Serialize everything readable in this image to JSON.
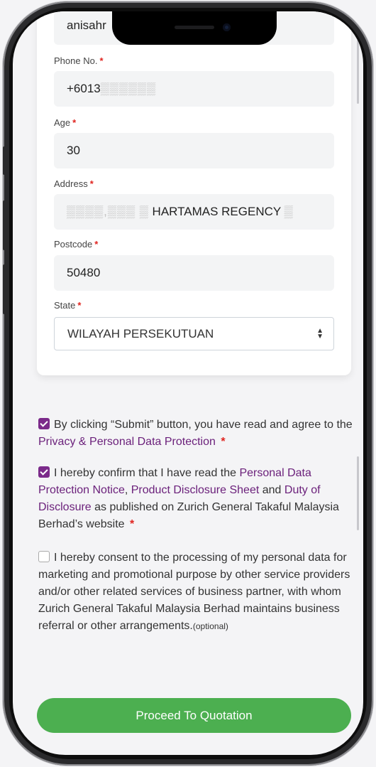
{
  "form": {
    "top_value": "anisahr",
    "phone": {
      "label": "Phone No.",
      "value_prefix": "+6013",
      "value_masked": "▒▒▒▒▒▒"
    },
    "age": {
      "label": "Age",
      "value": "30"
    },
    "address": {
      "label": "Address",
      "value_masked": "▒▒▒▒,▒▒▒ ▒",
      "value_visible": "HARTAMAS REGENCY",
      "value_tail_masked": "▒"
    },
    "postcode": {
      "label": "Postcode",
      "value": "50480"
    },
    "state": {
      "label": "State",
      "value": "WILAYAH PERSEKUTUAN"
    },
    "required_marker": "*"
  },
  "consents": [
    {
      "checked": true,
      "text_1": "By clicking “Submit” button, you have read and agree to the",
      "link_1": "Privacy & Personal Data Protection",
      "required": "*"
    },
    {
      "checked": true,
      "text_1": "I hereby confirm that I have read the",
      "link_1": "Personal Data Protection Notice",
      "sep_1": ",",
      "link_2": "Product Disclosure Sheet",
      "text_2": "and",
      "link_3": "Duty of Disclosure",
      "text_3": "as published on Zurich General Takaful Malaysia Berhad’s website",
      "required": "*"
    },
    {
      "checked": false,
      "text_1": "I hereby consent to the processing of my personal data for marketing and promotional purpose by other service providers and/or other related services of business partner, with whom Zurich General Takaful Malaysia Berhad maintains business referral or other arrangements.",
      "optional": "(optional)"
    }
  ],
  "actions": {
    "proceed_label": "Proceed To Quotation"
  },
  "colors": {
    "accent": "#6a1f7a",
    "button": "#4caf50",
    "required": "#e0241f"
  }
}
